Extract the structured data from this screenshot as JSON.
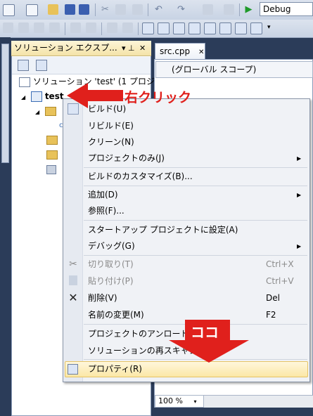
{
  "toolbar": {
    "config_combo": "Debug"
  },
  "solution_explorer": {
    "title": "ソリューション エクスプ...",
    "pin_glyph": "▾ ⊥",
    "close_glyph": "✕",
    "solution_label": "ソリューション 'test' (1 プロジ",
    "project_label": "test"
  },
  "editor": {
    "tab_label": "src.cpp",
    "tab_close": "✕",
    "scope_label": "(グローバル スコープ)",
    "zoom_label": "100 %"
  },
  "context_menu": {
    "items": [
      {
        "label": "ビルド(U)"
      },
      {
        "label": "リビルド(E)"
      },
      {
        "label": "クリーン(N)"
      },
      {
        "label": "プロジェクトのみ(J)"
      },
      {
        "label": "ビルドのカスタマイズ(B)..."
      },
      {
        "label": "追加(D)"
      },
      {
        "label": "参照(F)..."
      },
      {
        "label": "スタートアップ プロジェクトに設定(A)"
      },
      {
        "label": "デバッグ(G)"
      },
      {
        "label": "切り取り(T)",
        "shortcut": "Ctrl+X"
      },
      {
        "label": "貼り付け(P)",
        "shortcut": "Ctrl+V"
      },
      {
        "label": "削除(V)",
        "shortcut": "Del"
      },
      {
        "label": "名前の変更(M)",
        "shortcut": "F2"
      },
      {
        "label": "プロジェクトのアンロード(L)"
      },
      {
        "label": "ソリューションの再スキャン(S)"
      },
      {
        "label": "プロパティ(R)"
      }
    ]
  },
  "annotations": {
    "right_click": "右クリック",
    "here": "ココ"
  },
  "colors": {
    "annotation_red": "#e0201c",
    "highlight": "#fbe7a6",
    "ide_background": "#2b3c59"
  },
  "icons": {
    "run": "play-icon",
    "save": "save-icon",
    "cut": "scissors-icon",
    "delete": "delete-x-icon",
    "properties": "properties-icon"
  }
}
